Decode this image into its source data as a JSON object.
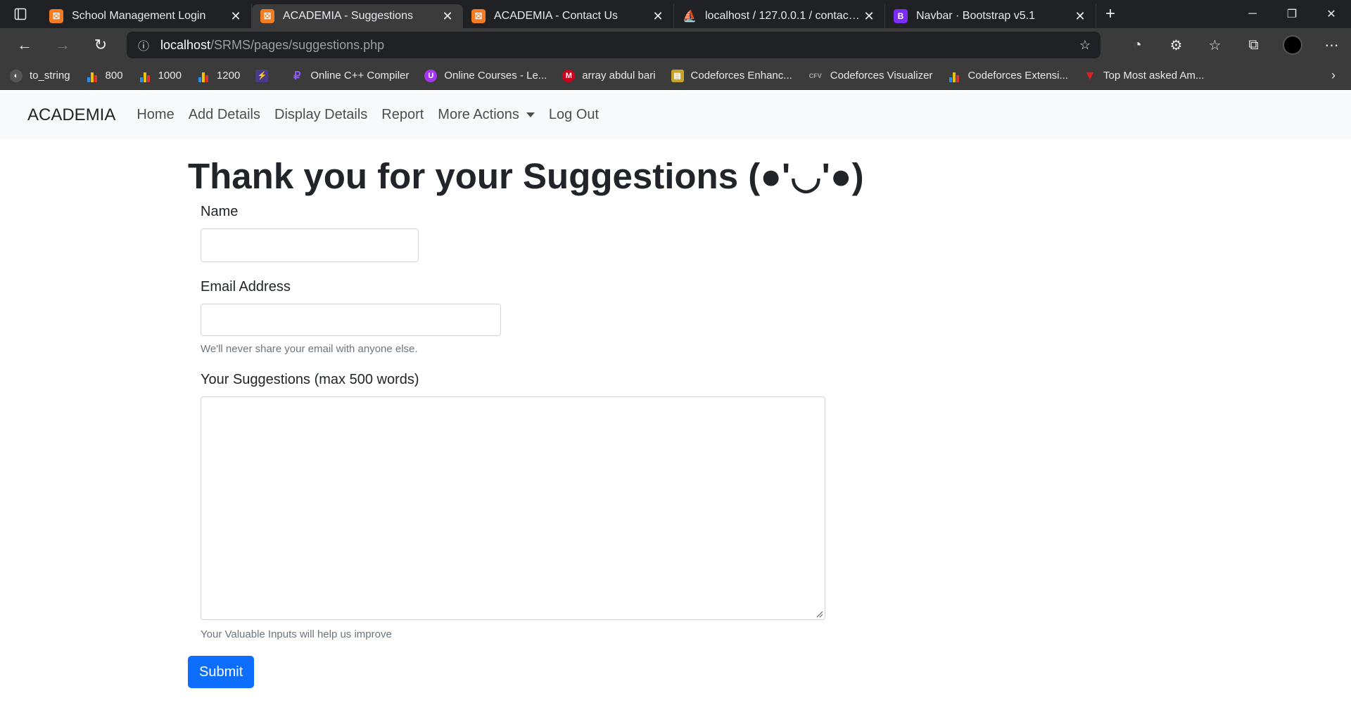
{
  "browser": {
    "tabs": [
      {
        "title": "School Management Login",
        "icon": "xampp-icon",
        "active": false
      },
      {
        "title": "ACADEMIA - Suggestions",
        "icon": "xampp-icon",
        "active": true
      },
      {
        "title": "ACADEMIA - Contact Us",
        "icon": "xampp-icon",
        "active": false
      },
      {
        "title": "localhost / 127.0.0.1 / contacts /",
        "icon": "phpmyadmin-icon",
        "active": false
      },
      {
        "title": "Navbar · Bootstrap v5.1",
        "icon": "bootstrap-icon",
        "active": false
      }
    ],
    "url_host": "localhost",
    "url_path": "/SRMS/pages/suggestions.php",
    "bookmarks": [
      {
        "label": "to_string",
        "icon": "circle-icon"
      },
      {
        "label": "800",
        "icon": "bar-chart-icon"
      },
      {
        "label": "1000",
        "icon": "bar-chart-icon"
      },
      {
        "label": "1200",
        "icon": "bar-chart-icon"
      },
      {
        "label": "",
        "icon": "bolt-icon"
      },
      {
        "label": "Online C++ Compiler",
        "icon": "compiler-icon"
      },
      {
        "label": "Online Courses - Le...",
        "icon": "udemy-icon"
      },
      {
        "label": "array abdul bari",
        "icon": "m-icon"
      },
      {
        "label": "Codeforces Enhanc...",
        "icon": "extension-icon"
      },
      {
        "label": "Codeforces Visualizer",
        "icon": "cfv-icon"
      },
      {
        "label": "Codeforces Extensi...",
        "icon": "bar-chart-icon"
      },
      {
        "label": "Top Most asked Am...",
        "icon": "triangle-icon"
      }
    ],
    "colors": {
      "tab_bg": "#202124",
      "toolbar_bg": "#3b3b3b",
      "xampp": "#f47b20",
      "bootstrap": "#7b2cf5"
    }
  },
  "navbar": {
    "brand": "ACADEMIA",
    "links": [
      "Home",
      "Add Details",
      "Display Details",
      "Report",
      "More Actions",
      "Log Out"
    ]
  },
  "page": {
    "heading": "Thank you for your Suggestions (●'◡'●)",
    "name_label": "Name",
    "email_label": "Email Address",
    "email_help": "We'll never share your email with anyone else.",
    "suggestions_label": "Your Suggestions (max 500 words)",
    "suggestions_help": "Your Valuable Inputs will help us improve",
    "submit_label": "Submit",
    "accent_color": "#0d6efd"
  }
}
